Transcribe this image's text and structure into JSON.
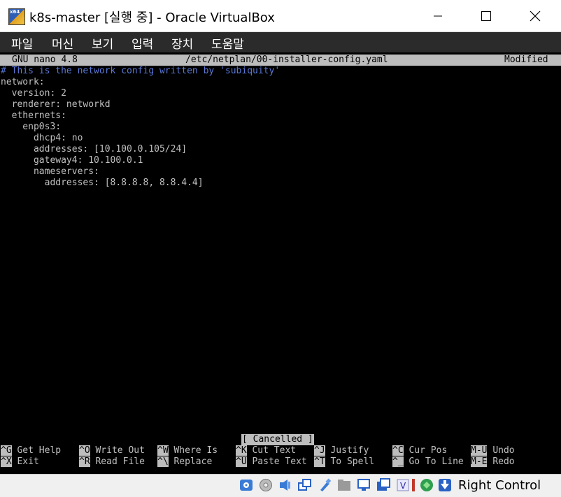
{
  "window": {
    "icon_tag": "x64",
    "title": "k8s-master [실행 중] - Oracle VirtualBox"
  },
  "menu": [
    "파일",
    "머신",
    "보기",
    "입력",
    "장치",
    "도움말"
  ],
  "nano": {
    "version": "GNU nano 4.8",
    "filename": "/etc/netplan/00-installer-config.yaml",
    "state": "Modified"
  },
  "file_lines": [
    "# This is the network config written by 'subiquity'",
    "network:",
    "  version: 2",
    "  renderer: networkd",
    "  ethernets:",
    "    enp0s3:",
    "      dhcp4: no",
    "      addresses: [10.100.0.105/24]",
    "      gateway4: 10.100.0.1",
    "      nameservers:",
    "        addresses: [8.8.8.8, 8.8.4.4]"
  ],
  "status_message": "[ Cancelled ]",
  "shortcuts": [
    {
      "key": "^G",
      "label": "Get Help"
    },
    {
      "key": "^O",
      "label": "Write Out"
    },
    {
      "key": "^W",
      "label": "Where Is"
    },
    {
      "key": "^K",
      "label": "Cut Text"
    },
    {
      "key": "^J",
      "label": "Justify"
    },
    {
      "key": "^C",
      "label": "Cur Pos"
    },
    {
      "key": "M-U",
      "label": "Undo"
    },
    {
      "key": "^X",
      "label": "Exit"
    },
    {
      "key": "^R",
      "label": "Read File"
    },
    {
      "key": "^\\",
      "label": "Replace"
    },
    {
      "key": "^U",
      "label": "Paste Text"
    },
    {
      "key": "^T",
      "label": "To Spell"
    },
    {
      "key": "^_",
      "label": "Go To Line"
    },
    {
      "key": "M-E",
      "label": "Redo"
    }
  ],
  "status_icons": [
    "hard-disk",
    "optical-drive",
    "audio",
    "network",
    "usb",
    "shared-folders",
    "display",
    "recording",
    "cpu",
    "v-marker",
    "mouse-integration",
    "keyboard-capture"
  ],
  "host_key": "Right Control"
}
